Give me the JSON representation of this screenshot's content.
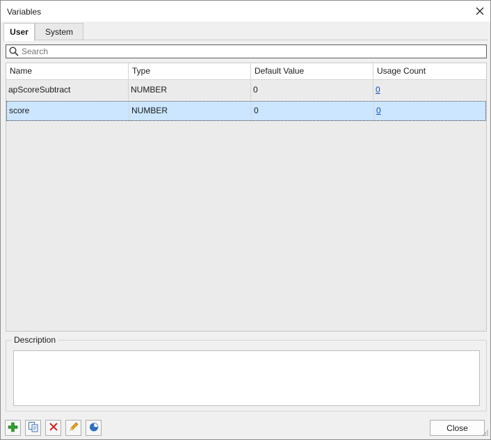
{
  "window": {
    "title": "Variables"
  },
  "tabs": [
    {
      "label": "User",
      "active": true
    },
    {
      "label": "System",
      "active": false
    }
  ],
  "search": {
    "placeholder": "Search",
    "value": ""
  },
  "grid": {
    "columns": [
      "Name",
      "Type",
      "Default Value",
      "Usage Count"
    ],
    "rows": [
      {
        "name": "apScoreSubtract",
        "type": "NUMBER",
        "default_value": "0",
        "usage_count": "0",
        "selected": false
      },
      {
        "name": "score",
        "type": "NUMBER",
        "default_value": "0",
        "usage_count": "0",
        "selected": true
      }
    ]
  },
  "description": {
    "label": "Description",
    "value": ""
  },
  "toolbar": {
    "icons": [
      "add-icon",
      "copy-icon",
      "delete-icon",
      "edit-icon",
      "usage-chart-icon"
    ],
    "close_label": "Close"
  },
  "colors": {
    "selection": "#cce6ff",
    "link": "#0b4fb8",
    "add": "#2e9e2e",
    "delete": "#d62020",
    "edit": "#e8a317"
  }
}
